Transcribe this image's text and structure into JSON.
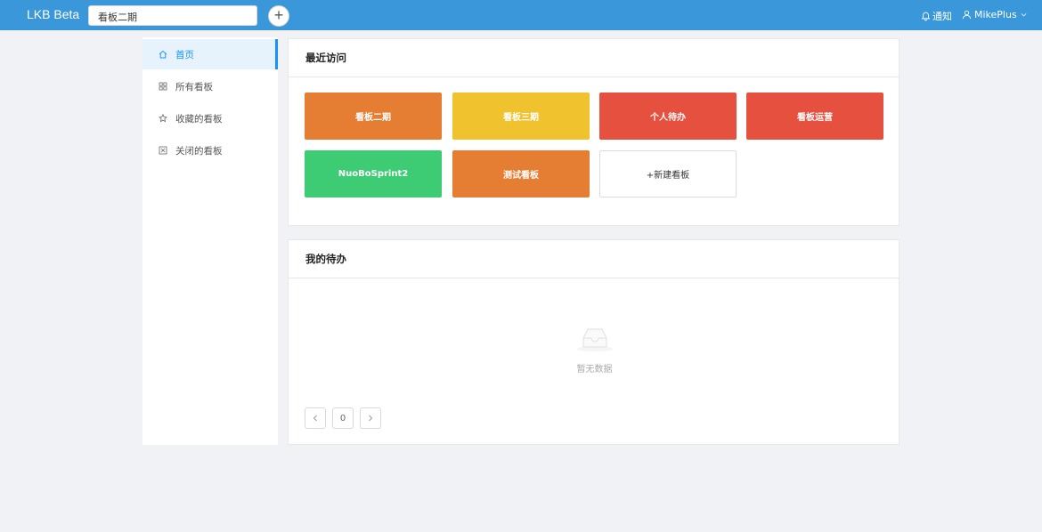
{
  "header": {
    "brand": "LKB Beta",
    "current_board": "看板二期",
    "add_label": "+",
    "notify_label": "通知",
    "user_name": "MikePlus",
    "accent_color": "#3a97d9"
  },
  "sidebar": {
    "items": [
      {
        "label": "首页",
        "icon": "home-icon",
        "active": true
      },
      {
        "label": "所有看板",
        "icon": "grid-icon",
        "active": false
      },
      {
        "label": "收藏的看板",
        "icon": "star-icon",
        "active": false
      },
      {
        "label": "关闭的看板",
        "icon": "close-box-icon",
        "active": false
      }
    ]
  },
  "recent": {
    "title": "最近访问",
    "boards": [
      {
        "label": "看板二期",
        "color": "#e57e33"
      },
      {
        "label": "看板三期",
        "color": "#f0c22e"
      },
      {
        "label": "个人待办",
        "color": "#e5503f"
      },
      {
        "label": "看板运营",
        "color": "#e5503f"
      },
      {
        "label": "NuoBoSprint2",
        "color": "#3dcc74"
      },
      {
        "label": "测试看板",
        "color": "#e57e33"
      }
    ],
    "new_board_label": "+新建看板"
  },
  "todo": {
    "title": "我的待办",
    "empty_text": "暂无数据",
    "page_number": "0",
    "prev_icon": "chevron-left-icon",
    "next_icon": "chevron-right-icon"
  }
}
